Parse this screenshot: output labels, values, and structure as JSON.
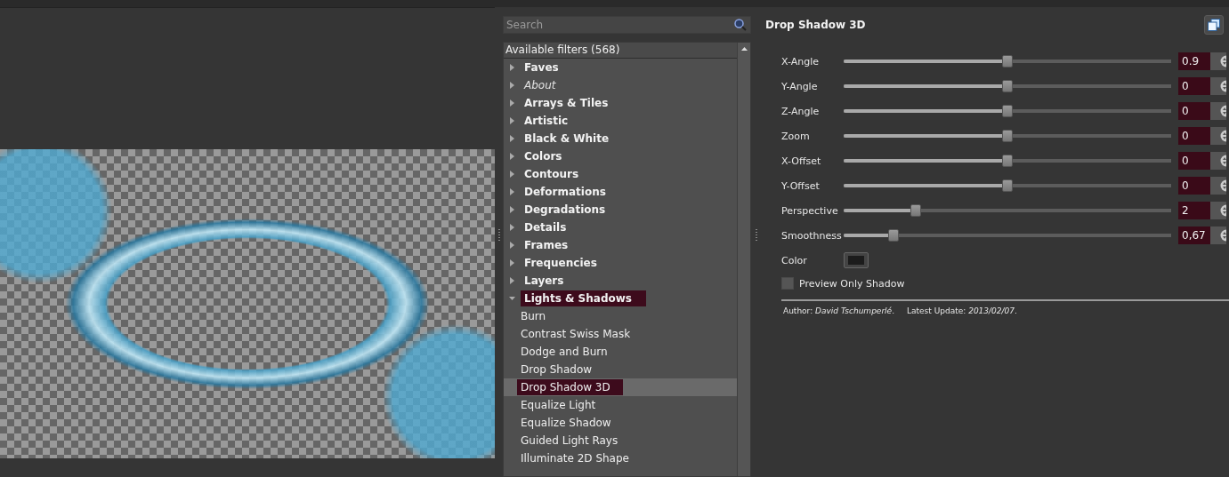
{
  "search": {
    "placeholder": "Search"
  },
  "filters": {
    "header": "Available filters (568)",
    "items": [
      {
        "label": "Faves",
        "kind": "category",
        "expanded": false
      },
      {
        "label": "About",
        "kind": "about",
        "expanded": false
      },
      {
        "label": "Arrays & Tiles",
        "kind": "category",
        "expanded": false
      },
      {
        "label": "Artistic",
        "kind": "category",
        "expanded": false
      },
      {
        "label": "Black & White",
        "kind": "category",
        "expanded": false
      },
      {
        "label": "Colors",
        "kind": "category",
        "expanded": false
      },
      {
        "label": "Contours",
        "kind": "category",
        "expanded": false
      },
      {
        "label": "Deformations",
        "kind": "category",
        "expanded": false
      },
      {
        "label": "Degradations",
        "kind": "category",
        "expanded": false
      },
      {
        "label": "Details",
        "kind": "category",
        "expanded": false
      },
      {
        "label": "Frames",
        "kind": "category",
        "expanded": false
      },
      {
        "label": "Frequencies",
        "kind": "category",
        "expanded": false
      },
      {
        "label": "Layers",
        "kind": "category",
        "expanded": false
      },
      {
        "label": "Lights & Shadows",
        "kind": "category",
        "expanded": true,
        "children": [
          {
            "label": "Burn",
            "selected": false
          },
          {
            "label": "Contrast Swiss Mask",
            "selected": false
          },
          {
            "label": "Dodge and Burn",
            "selected": false
          },
          {
            "label": "Drop Shadow",
            "selected": false
          },
          {
            "label": "Drop Shadow 3D",
            "selected": true
          },
          {
            "label": "Equalize Light",
            "selected": false
          },
          {
            "label": "Equalize Shadow",
            "selected": false
          },
          {
            "label": "Guided Light Rays",
            "selected": false
          },
          {
            "label": "Illuminate 2D Shape",
            "selected": false
          }
        ]
      }
    ]
  },
  "filter": {
    "title": "Drop Shadow 3D",
    "params": [
      {
        "kind": "slider",
        "label": "X-Angle",
        "level": 0.5,
        "value": "0.9"
      },
      {
        "kind": "slider",
        "label": "Y-Angle",
        "level": 0.5,
        "value": "0"
      },
      {
        "kind": "slider",
        "label": "Z-Angle",
        "level": 0.5,
        "value": "0"
      },
      {
        "kind": "slider",
        "label": "Zoom",
        "level": 0.5,
        "value": "0"
      },
      {
        "kind": "slider",
        "label": "X-Offset",
        "level": 0.5,
        "value": "0"
      },
      {
        "kind": "slider",
        "label": "Y-Offset",
        "level": 0.5,
        "value": "0"
      },
      {
        "kind": "slider",
        "label": "Perspective",
        "level": 0.21,
        "value": "2"
      },
      {
        "kind": "slider",
        "label": "Smoothness",
        "level": 0.14,
        "value": "0,67"
      },
      {
        "kind": "color",
        "label": "Color",
        "color": "#1c1c1c"
      },
      {
        "kind": "checkbox",
        "label": "Preview Only Shadow",
        "checked": false
      }
    ],
    "author": "Author: *David Tschumperlé*.",
    "update": "Latest Update: *2013/02/07*."
  }
}
